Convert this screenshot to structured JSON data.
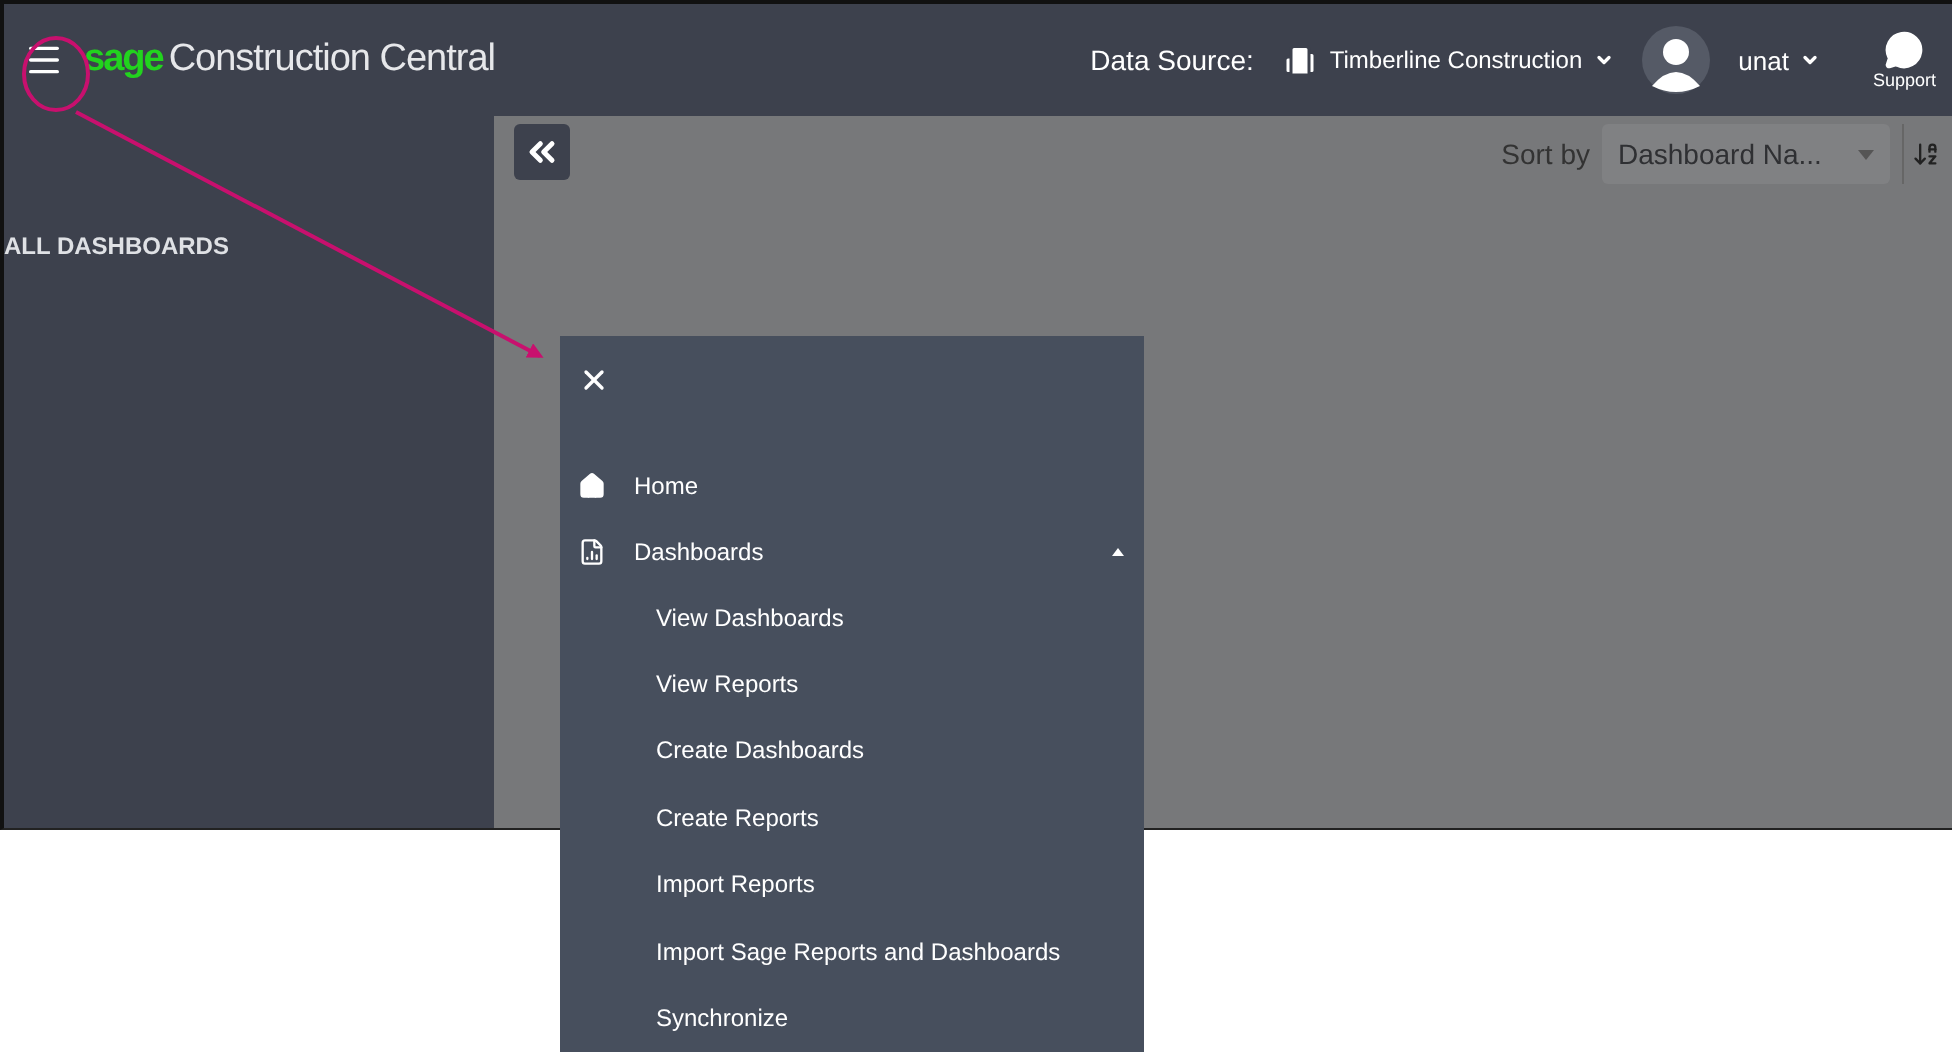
{
  "header": {
    "logo_brand": "sage",
    "logo_text": "Construction Central",
    "data_source_label": "Data Source:",
    "data_source_value": "Timberline Construction",
    "user": "unat",
    "support": "Support"
  },
  "sidebar": {
    "heading": "ALL DASHBOARDS"
  },
  "toolbar": {
    "sort_label": "Sort by",
    "sort_value": "Dashboard Na..."
  },
  "menu": {
    "items": [
      {
        "label": "Home",
        "kind": "home"
      },
      {
        "label": "Dashboards",
        "kind": "dashboards",
        "expanded": true,
        "children": [
          {
            "label": "View Dashboards"
          },
          {
            "label": "View Reports"
          },
          {
            "label": "Create Dashboards"
          },
          {
            "label": "Create Reports"
          },
          {
            "label": "Import Reports"
          },
          {
            "label": "Import Sage Reports and Dashboards"
          },
          {
            "label": "Synchronize"
          }
        ]
      }
    ]
  }
}
